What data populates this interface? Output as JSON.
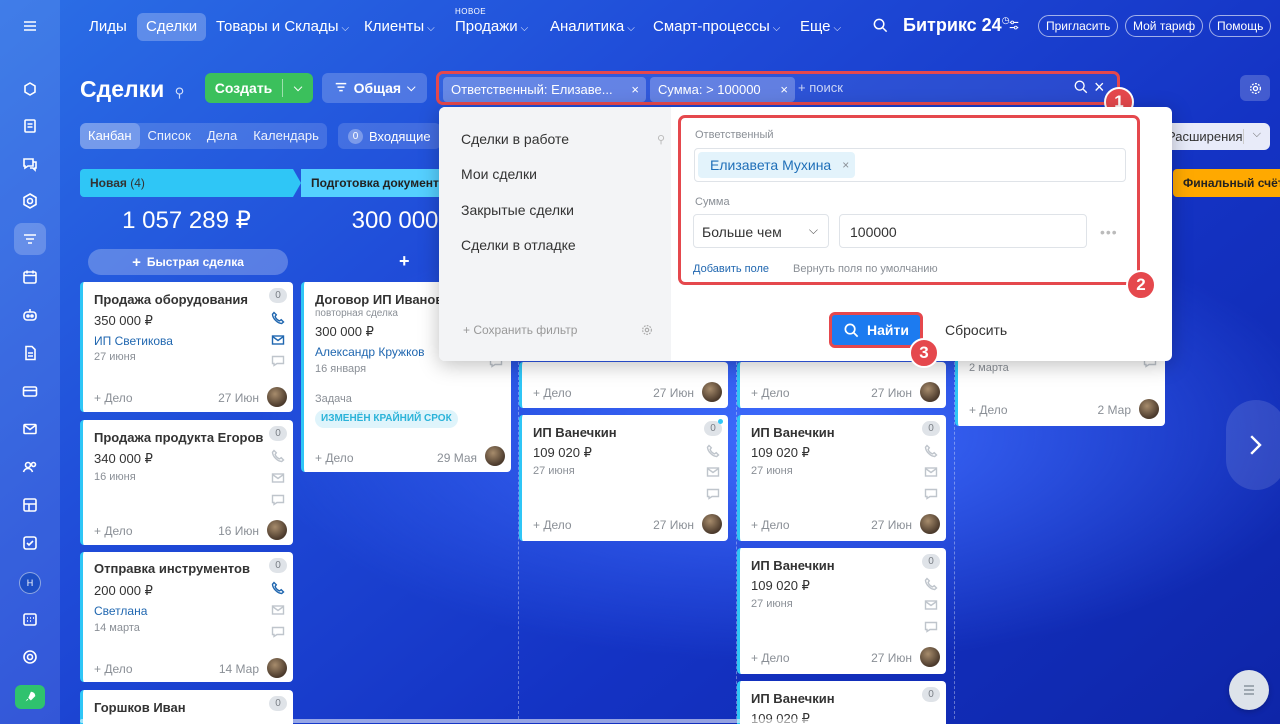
{
  "topnav": {
    "items": [
      {
        "label": "Лиды",
        "chevron": false,
        "active": false
      },
      {
        "label": "Сделки",
        "chevron": false,
        "active": true
      },
      {
        "label": "Товары и Склады",
        "chevron": true,
        "active": false
      },
      {
        "label": "Клиенты",
        "chevron": true,
        "active": false
      },
      {
        "label": "Продажи",
        "chevron": true,
        "active": false
      },
      {
        "label": "Аналитика",
        "chevron": true,
        "active": false
      },
      {
        "label": "Смарт-процессы",
        "chevron": true,
        "active": false
      },
      {
        "label": "Еще",
        "chevron": true,
        "active": false
      }
    ],
    "new_label": "НОВОЕ",
    "logo": "Битрикс 24",
    "invite": "Пригласить",
    "tariff": "Мой тариф",
    "help": "Помощь"
  },
  "header": {
    "title": "Сделки",
    "create": "Создать",
    "general": "Общая",
    "chips": [
      {
        "label": "Ответственный: Елизаве..."
      },
      {
        "label": "Сумма: > 100000"
      }
    ],
    "search_placeholder": "+ поиск",
    "badges": [
      "1",
      "2",
      "3"
    ]
  },
  "views": {
    "tabs": [
      {
        "label": "Канбан",
        "active": true
      },
      {
        "label": "Список",
        "active": false
      },
      {
        "label": "Дела",
        "active": false
      },
      {
        "label": "Календарь",
        "active": false
      }
    ],
    "incoming_count": "0",
    "incoming": "Входящие",
    "extensions": "Расширения"
  },
  "columns": {
    "new": {
      "title": "Новая",
      "count": "(4)",
      "sum": "1 057 289 ₽",
      "color": "#2fc6f6"
    },
    "prep": {
      "title": "Подготовка документов",
      "sum": "300 000 ₽",
      "color": "#55d0ff"
    },
    "final": {
      "title": "Финальный счёт",
      "color": "#ffa900"
    }
  },
  "quick_deal": "Быстрая сделка",
  "cards": {
    "c1": {
      "title": "Продажа оборудования",
      "amount": "350 000 ₽",
      "company": "ИП Светикова",
      "date": "27 июня",
      "deal": "+ Дело",
      "deal_date": "27 Июн",
      "count": "0"
    },
    "c2": {
      "title": "Продажа продукта Егоров",
      "amount": "340 000 ₽",
      "date": "16 июня",
      "deal": "+ Дело",
      "deal_date": "16 Июн",
      "count": "0"
    },
    "c3": {
      "title": "Отправка инструментов",
      "amount": "200 000 ₽",
      "company": "Светлана",
      "date": "14 марта",
      "deal": "+ Дело",
      "deal_date": "14 Мар",
      "count": "0"
    },
    "c4": {
      "title": "Горшков Иван",
      "count": "0"
    },
    "c5": {
      "title": "Договор ИП Иванов",
      "subtitle": "повторная сделка",
      "amount": "300 000 ₽",
      "contact": "Александр Кружков",
      "date": "16 января",
      "task_label": "Задача",
      "tag": "ИЗМЕНЁН КРАЙНИЙ СРОК",
      "deal": "+ Дело",
      "deal_date": "29 Мая",
      "count": "0"
    },
    "c6": {
      "deal": "+ Дело",
      "deal_date": "27 Июн"
    },
    "c7": {
      "title": "ИП Ванечкин",
      "amount": "109 020 ₽",
      "date": "27 июня",
      "deal": "+ Дело",
      "deal_date": "27 Июн",
      "count": "0"
    },
    "c8": {
      "deal": "+ Дело",
      "deal_date": "27 Июн"
    },
    "c9": {
      "title": "ИП Ванечкин",
      "amount": "109 020 ₽",
      "date": "27 июня",
      "deal": "+ Дело",
      "deal_date": "27 Июн",
      "count": "0"
    },
    "c10": {
      "title": "ИП Ванечкин",
      "amount": "109 020 ₽",
      "date": "27 июня",
      "deal": "+ Дело",
      "deal_date": "27 Июн",
      "count": "0"
    },
    "c11": {
      "title": "ИП Ванечкин",
      "amount": "109 020 ₽",
      "count": "0"
    },
    "c12": {
      "date": "2 марта",
      "deal": "+ Дело",
      "deal_date": "2 Мар"
    }
  },
  "popup": {
    "presets": [
      "Сделки в работе",
      "Мои сделки",
      "Закрытые сделки",
      "Сделки в отладке"
    ],
    "save_filter": "+ Сохранить фильтр",
    "responsible_label": "Ответственный",
    "responsible_value": "Елизавета Мухина",
    "sum_label": "Сумма",
    "sum_operator": "Больше чем",
    "sum_value": "100000",
    "add_field": "Добавить поле",
    "reset_fields": "Вернуть поля по умолчанию",
    "find": "Найти",
    "reset": "Сбросить"
  },
  "colors": {
    "accent_red": "#e5484d",
    "primary_blue": "#1c7bf0",
    "create_green": "#3bc05c",
    "link": "#2067b0"
  }
}
